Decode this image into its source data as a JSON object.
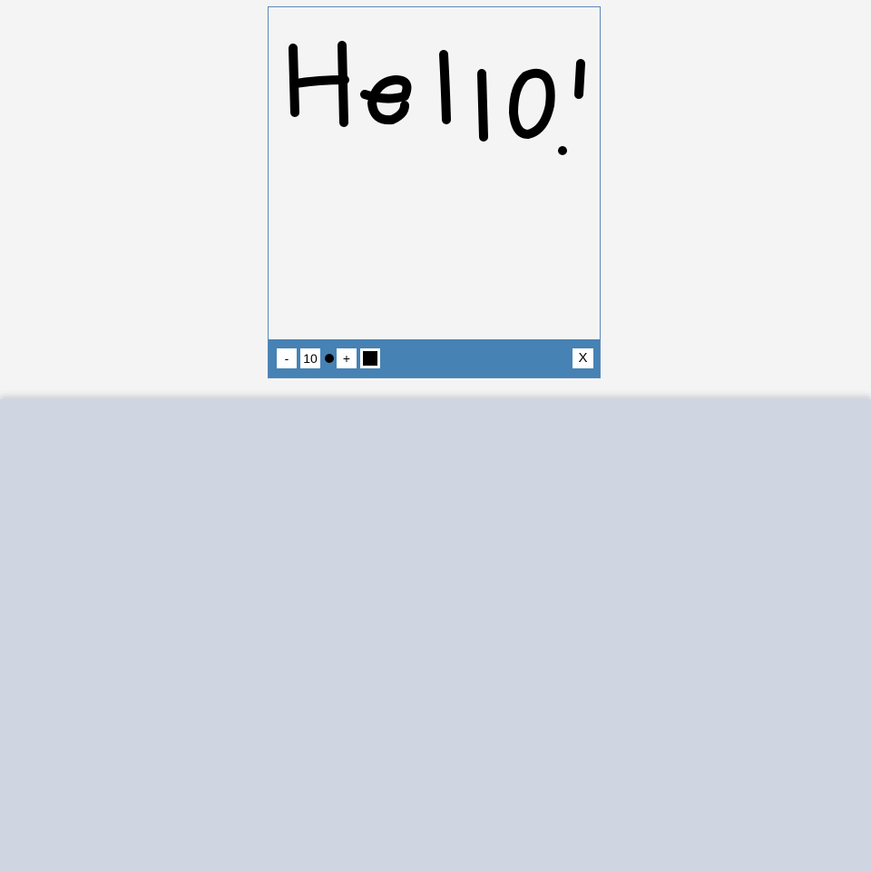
{
  "toolbar": {
    "decrease_label": "-",
    "brush_size": "10",
    "increase_label": "+",
    "close_label": "X",
    "brush_color": "#000000"
  },
  "canvas": {
    "handwritten_text": "Hello!",
    "stroke_color": "#000000"
  },
  "colors": {
    "page_background": "#f4f4f4",
    "lower_background": "#cfd5e1",
    "toolbar_background": "#4682b4",
    "widget_border": "#5a88b8"
  }
}
